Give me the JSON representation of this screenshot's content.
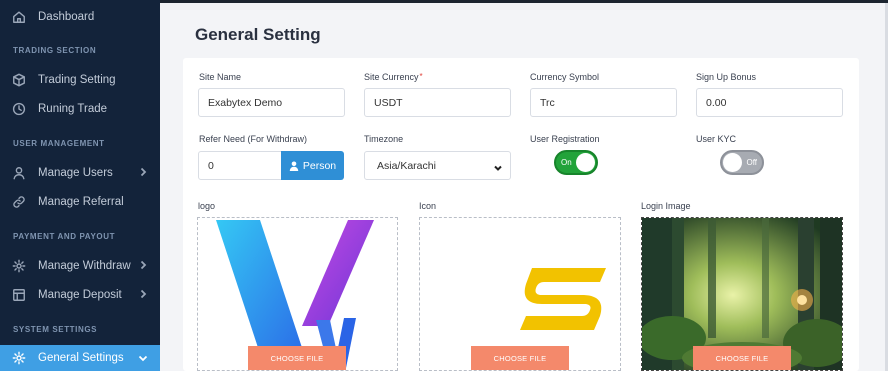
{
  "sidebar": {
    "dashboard": "Dashboard",
    "sections": {
      "trading": "TRADING SECTION",
      "users": "USER MANAGEMENT",
      "payment": "PAYMENT AND PAYOUT",
      "system": "SYSTEM SETTINGS"
    },
    "items": {
      "trading_setting": "Trading Setting",
      "runing_trade": "Runing Trade",
      "manage_users": "Manage Users",
      "manage_referral": "Manage Referral",
      "manage_withdraw": "Manage Withdraw",
      "manage_deposit": "Manage Deposit",
      "general_settings": "General Settings"
    },
    "active_color": "#3f9fe4"
  },
  "page": {
    "title": "General Setting"
  },
  "form": {
    "site_name": {
      "label": "Site Name",
      "value": "Exabytex Demo"
    },
    "site_currency": {
      "label": "Site Currency",
      "required_mark": "*",
      "value": "USDT"
    },
    "currency_symbol": {
      "label": "Currency Symbol",
      "value": "Trc"
    },
    "signup_bonus": {
      "label": "Sign Up Bonus",
      "value": "0.00"
    },
    "refer_need": {
      "label": "Refer Need (For Withdraw)",
      "value": "0",
      "button": "Person"
    },
    "timezone": {
      "label": "Timezone",
      "value": "Asia/Karachi"
    },
    "user_registration": {
      "label": "User Registration",
      "state": "On",
      "enabled": true
    },
    "user_kyc": {
      "label": "User KYC",
      "state": "Off",
      "enabled": false
    }
  },
  "uploads": {
    "logo": {
      "label": "logo",
      "button": "CHOOSE FILE"
    },
    "icon": {
      "label": "Icon",
      "button": "CHOOSE FILE"
    },
    "login_image": {
      "label": "Login Image",
      "button": "CHOOSE FILE"
    }
  },
  "colors": {
    "sidebar_bg": "#13233a",
    "toggle_on": "#22a33a",
    "toggle_off": "#a7abb2",
    "primary_button": "#2f8fd6",
    "choose_file_button": "#f4896b",
    "icon_yellow": "#f2c200"
  }
}
